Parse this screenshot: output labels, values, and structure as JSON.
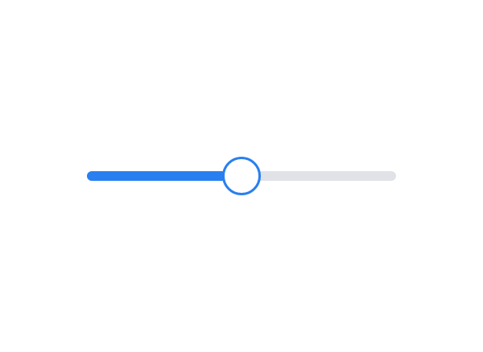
{
  "slider": {
    "value": 0.5,
    "min": 0,
    "max": 1,
    "fill_color": "#2a7ff0",
    "track_color": "#e0e2e8",
    "thumb_border_color": "#2a7ff0",
    "thumb_fill_color": "#ffffff"
  }
}
